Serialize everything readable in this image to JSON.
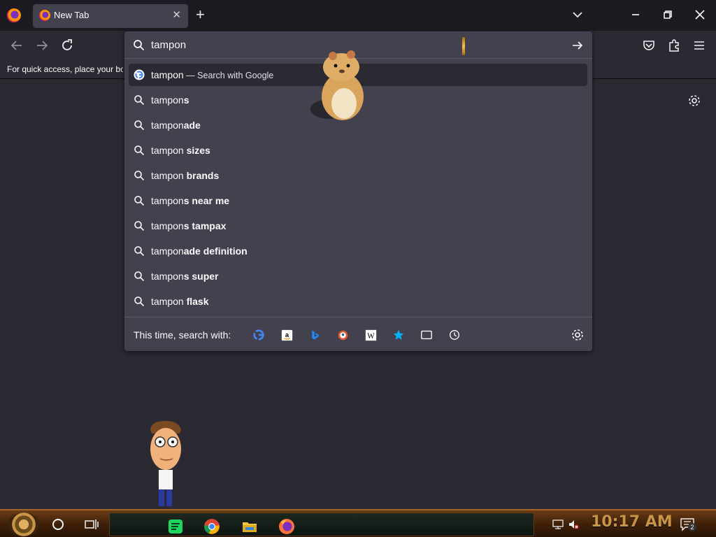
{
  "tab": {
    "title": "New Tab"
  },
  "urlbar": {
    "value": "tampon"
  },
  "bookmarks": {
    "hint": "For quick access, place your bookmarks here"
  },
  "suggestions": [
    {
      "prefix": "tampon",
      "suffix": "",
      "action": "Search with Google",
      "icon": "google-icon"
    },
    {
      "prefix": "tampon",
      "suffix": "s",
      "icon": "search-icon"
    },
    {
      "prefix": "tampon",
      "suffix": "ade",
      "icon": "search-icon"
    },
    {
      "prefix": "tampon",
      "suffix": " sizes",
      "icon": "search-icon"
    },
    {
      "prefix": "tampon",
      "suffix": " brands",
      "icon": "search-icon"
    },
    {
      "prefix": "tampon",
      "suffix": "s near me",
      "icon": "search-icon"
    },
    {
      "prefix": "tampon",
      "suffix": "s tampax",
      "icon": "search-icon"
    },
    {
      "prefix": "tampon",
      "suffix": "ade definition",
      "icon": "search-icon"
    },
    {
      "prefix": "tampon",
      "suffix": "s super",
      "icon": "search-icon"
    },
    {
      "prefix": "tampon",
      "suffix": " flask",
      "icon": "search-icon"
    }
  ],
  "oneoff": {
    "label": "This time, search with:",
    "engines": [
      "google-icon",
      "amazon-icon",
      "bing-icon",
      "duckduckgo-icon",
      "wikipedia-icon",
      "bookmarks-star-icon",
      "tabs-icon",
      "history-icon"
    ]
  },
  "taskbar": {
    "clock": "10:17 AM",
    "notification_count": "2",
    "apps": [
      "spotify-icon",
      "chrome-icon",
      "file-explorer-icon",
      "firefox-icon"
    ]
  },
  "colors": {
    "panel": "#42414d",
    "background": "#2b2a33",
    "tabstrip": "#1c1b22",
    "clock": "#c89448"
  }
}
